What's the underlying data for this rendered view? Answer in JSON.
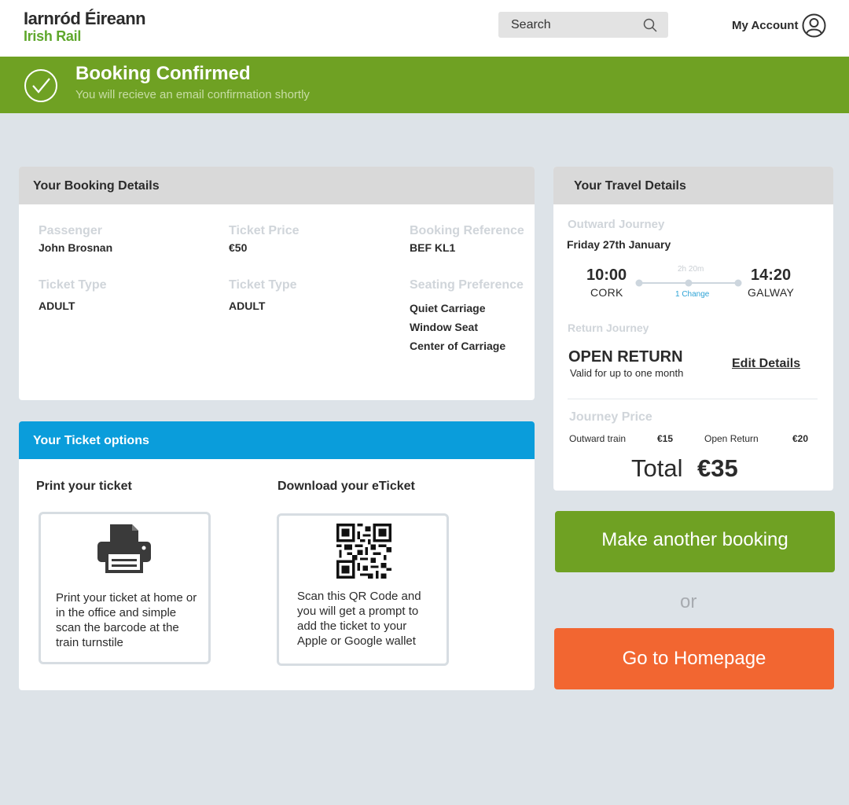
{
  "header": {
    "logo_line1": "Iarnród Éireann",
    "logo_line2": "Irish Rail",
    "search_placeholder": "Search",
    "account_label": "My Account"
  },
  "banner": {
    "title": "Booking Confirmed",
    "subtitle": "You will recieve an email confirmation shortly"
  },
  "booking": {
    "heading": "Your Booking Details",
    "passenger_label": "Passenger",
    "passenger": "John Brosnan",
    "price_label": "Ticket Price",
    "price": "€50",
    "ref_label": "Booking Reference",
    "ref": "BEF KL1",
    "type1_label": "Ticket Type",
    "type1": "ADULT",
    "type2_label": "Ticket Type",
    "type2": "ADULT",
    "seating_label": "Seating Preference",
    "seating": [
      "Quiet Carriage",
      "Window Seat",
      "Center of Carriage"
    ]
  },
  "options": {
    "heading": "Your Ticket options",
    "print_title": "Print your ticket",
    "print_text": "Print your ticket at home or in the office and simple scan the barcode at the train turnstile",
    "download_title": "Download your eTicket",
    "download_text": "Scan this QR Code and you will get a prompt to add the ticket to your Apple or Google wallet"
  },
  "travel": {
    "heading": "Your Travel Details",
    "outward_label": "Outward Journey",
    "outward_date": "Friday 27th January",
    "depart_time": "10:00",
    "depart_station": "CORK",
    "duration": "2h 20m",
    "changes": "1 Change",
    "arrive_time": "14:20",
    "arrive_station": "GALWAY",
    "return_label": "Return Journey",
    "return_type": "OPEN RETURN",
    "return_validity": "Valid for up to one month",
    "edit_label": "Edit Details",
    "price_label": "Journey Price",
    "outward_train_label": "Outward train",
    "outward_train_price": "€15",
    "open_return_label": "Open Return",
    "open_return_price": "€20",
    "total_label": "Total",
    "total_value": "€35"
  },
  "actions": {
    "another_booking": "Make another booking",
    "or": "or",
    "homepage": "Go to Homepage"
  },
  "colors": {
    "brand_green": "#6fa123",
    "info_blue": "#0a9ddb",
    "action_orange": "#f26631",
    "logo_green": "#5fa72c"
  }
}
